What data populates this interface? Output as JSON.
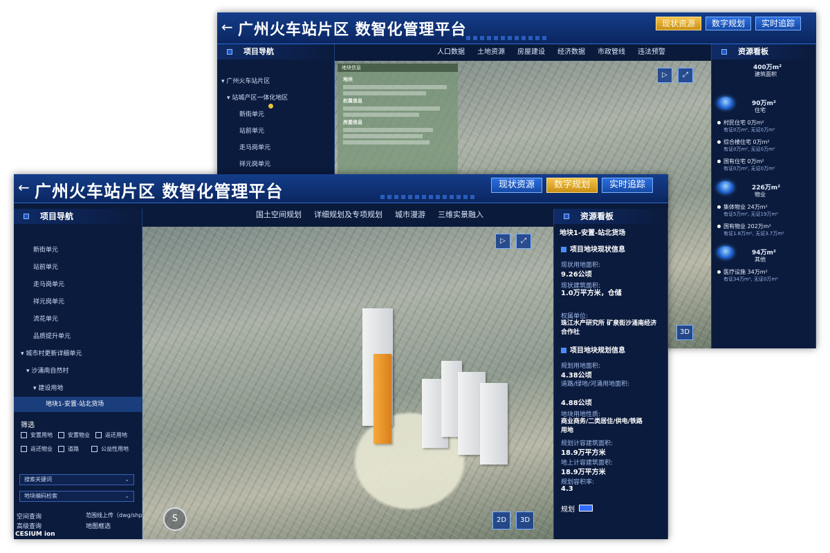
{
  "back_window": {
    "title": "广州火车站片区 数智化管理平台",
    "buttons": [
      {
        "label": "现状资源",
        "active": true
      },
      {
        "label": "数字规划",
        "active": false
      },
      {
        "label": "实时追踪",
        "active": false
      }
    ],
    "tabs": [
      "人口数据",
      "土地资源",
      "房屋建设",
      "经济数据",
      "市政管线",
      "违法预警"
    ],
    "nav": {
      "title": "项目导航",
      "items": [
        "广州火车站片区",
        "站城产区一体化地区",
        "新街单元",
        "站前单元",
        "走马岗单元",
        "祥元岗单元"
      ]
    },
    "popup": {
      "header": "地块信息",
      "sections": [
        "地块",
        "权属信息",
        "房屋信息"
      ]
    },
    "scene_buttons": [
      "选择",
      "全景"
    ],
    "board": {
      "title": "资源看板",
      "total_value": "400万m²",
      "total_label": "建筑面积",
      "groups": [
        {
          "value": "90万m²",
          "label": "住宅",
          "items": [
            {
              "name": "村民住宅 0万m²",
              "sub": "有证0万m², 无证0万m²"
            },
            {
              "name": "综合楼住宅 0万m²",
              "sub": "有证0万m², 无证0万m²"
            },
            {
              "name": "国有住宅 0万m²",
              "sub": "有证0万m², 无证0万m²"
            }
          ]
        },
        {
          "value": "226万m²",
          "label": "物业",
          "items": [
            {
              "name": "集体物业 24万m²",
              "sub": "有证5万m², 无证19万m²"
            },
            {
              "name": "国有物业 202万m²",
              "sub": "有证1.8万m², 无证3.7万m²"
            }
          ]
        },
        {
          "value": "94万m²",
          "label": "其他",
          "items": [
            {
              "name": "医疗设施 34万m²",
              "sub": "有证34万m², 无证0万m²"
            }
          ]
        }
      ]
    },
    "mode_label": "3D"
  },
  "front_window": {
    "title": "广州火车站片区 数智化管理平台",
    "buttons": [
      {
        "label": "现状资源",
        "active": false
      },
      {
        "label": "数字规划",
        "active": true
      },
      {
        "label": "实时追踪",
        "active": false
      }
    ],
    "tabs": [
      "国土空间规划",
      "详细规划及专项规划",
      "城市漫游",
      "三维实景融入"
    ],
    "nav": {
      "title": "项目导航",
      "items": [
        "新街单元",
        "站前单元",
        "走马岗单元",
        "祥元岗单元",
        "流花单元",
        "品质提升单元",
        "城市村更新详细单元",
        "沙涌南自然村",
        "建设用地"
      ],
      "selected": "地块1-安置-站北货场"
    },
    "filter": {
      "title": "筛选",
      "options": [
        "安置用地",
        "安置物业",
        "返还用地",
        "返还物业",
        "道路",
        "公益性用地"
      ]
    },
    "selects": [
      "搜索关键词",
      "地块编码检索"
    ],
    "bottom_links": [
      "空间查询",
      "范围线上传（dwg/shp）",
      "高级查询",
      "地图框选"
    ],
    "cesium": "CESIUM ion",
    "scene_buttons": [
      "选择",
      "全景"
    ],
    "mode_buttons": [
      "2D",
      "3D"
    ],
    "compass": "S",
    "board": {
      "title": "资源看板",
      "plot_name": "地块1-安置-站北货场",
      "section1": "项目地块现状信息",
      "fields1": [
        {
          "label": "现状用地面积:",
          "value": "9.26公顷"
        },
        {
          "label": "现状建筑面积:",
          "value": "1.0万平方米，仓储"
        },
        {
          "label": "权属单位:",
          "value": "珠江水产研究所 矿泉街沙涌南经济合作社"
        }
      ],
      "section2": "项目地块规划信息",
      "fields2": [
        {
          "label": "规划用地面积:",
          "value": "4.38公顷"
        },
        {
          "label": "道路/绿地/河涌用地面积:",
          "value": "4.88公顷"
        },
        {
          "label": "地块用地性质:",
          "value": "商业商务/二类居住/供电/铁路用地"
        },
        {
          "label": "规划计容建筑面积:",
          "value": "18.9万平方米"
        },
        {
          "label": "地上计容建筑面积:",
          "value": "18.9万平方米"
        },
        {
          "label": "规划容积率:",
          "value": "4.3"
        }
      ],
      "toggle_label": "规划"
    }
  },
  "colors": {
    "header": "#143d8a",
    "panel": "#0b1b3d",
    "accent": "#2c6fe0",
    "active": "#f3c34a"
  }
}
